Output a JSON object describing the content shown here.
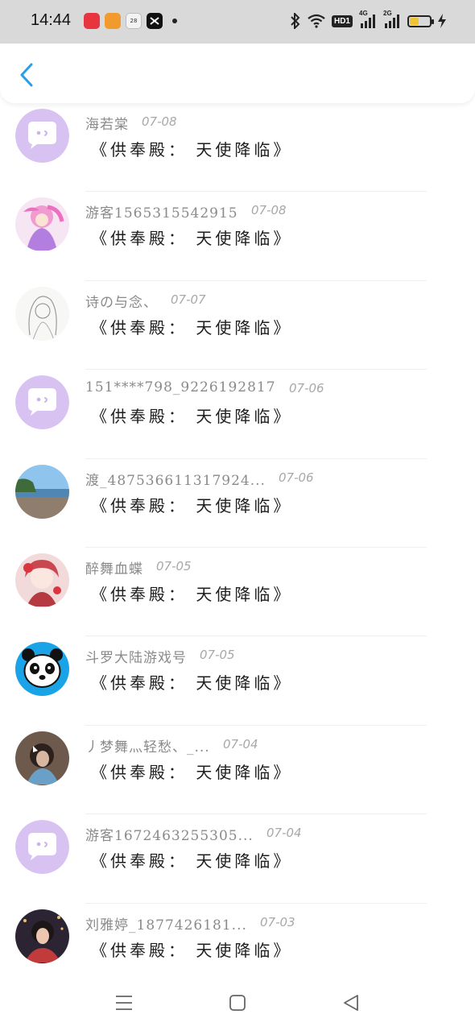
{
  "status_bar": {
    "time": "14:44",
    "notification_icons": [
      "xiaohongshu-icon",
      "dianping-icon",
      "calendar-icon",
      "capcut-icon"
    ],
    "calendar_day": "28",
    "network_labels": [
      "4G",
      "2G"
    ],
    "hd_label": "HD1",
    "battery_level": 0.45,
    "battery_color": "#f1c232"
  },
  "header": {
    "back_icon": "chevron-left-icon",
    "accent": "#2a9fe8"
  },
  "items": [
    {
      "name": "海若棠",
      "date": "07-08",
      "message": "《供奉殿： 天使降临》",
      "avatar": "default-purple"
    },
    {
      "name": "游客1565315542915",
      "date": "07-08",
      "message": "《供奉殿： 天使降临》",
      "avatar": "anime-pink"
    },
    {
      "name": "诗の与念、",
      "date": "07-07",
      "message": "《供奉殿： 天使降临》",
      "avatar": "sketch-girl"
    },
    {
      "name": "151****798_9226192817",
      "date": "07-06",
      "message": "《供奉殿： 天使降临》",
      "avatar": "default-purple"
    },
    {
      "name": "渡_487536611317924...",
      "date": "07-06",
      "message": "《供奉殿： 天使降临》",
      "avatar": "beach"
    },
    {
      "name": "醉舞血蝶",
      "date": "07-05",
      "message": "《供奉殿： 天使降临》",
      "avatar": "anime-red"
    },
    {
      "name": "斗罗大陆游戏号",
      "date": "07-05",
      "message": "《供奉殿： 天使降临》",
      "avatar": "panda"
    },
    {
      "name": "丿梦舞灬轻愁、_...",
      "date": "07-04",
      "message": "《供奉殿： 天使降临》",
      "avatar": "girl-photo"
    },
    {
      "name": "游客1672463255305...",
      "date": "07-04",
      "message": "《供奉殿： 天使降临》",
      "avatar": "default-purple"
    },
    {
      "name": "刘雅婷_1877426181...",
      "date": "07-03",
      "message": "《供奉殿： 天使降临》",
      "avatar": "girl-night"
    }
  ],
  "navbar": {
    "icons": [
      "menu-icon",
      "home-square-icon",
      "back-triangle-icon"
    ]
  }
}
